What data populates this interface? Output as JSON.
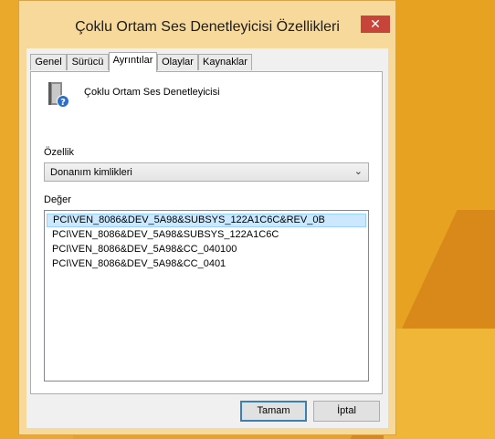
{
  "window": {
    "title": "Çoklu Ortam Ses Denetleyicisi Özellikleri",
    "close_glyph": "✕"
  },
  "tabs": [
    {
      "label": "Genel"
    },
    {
      "label": "Sürücü"
    },
    {
      "label": "Ayrıntılar",
      "active": true
    },
    {
      "label": "Olaylar"
    },
    {
      "label": "Kaynaklar"
    }
  ],
  "device": {
    "name": "Çoklu Ortam Ses Denetleyicisi",
    "icon": "speaker-question-icon"
  },
  "property": {
    "label": "Özellik",
    "selected": "Donanım kimlikleri",
    "arrow": "⌄"
  },
  "value": {
    "label": "Değer",
    "items": [
      "PCI\\VEN_8086&DEV_5A98&SUBSYS_122A1C6C&REV_0B",
      "PCI\\VEN_8086&DEV_5A98&SUBSYS_122A1C6C",
      "PCI\\VEN_8086&DEV_5A98&CC_040100",
      "PCI\\VEN_8086&DEV_5A98&CC_0401"
    ],
    "selected_index": 0
  },
  "buttons": {
    "ok": "Tamam",
    "cancel": "İptal"
  },
  "colors": {
    "title_bar": "#f6d99b",
    "close_button": "#c7443a",
    "selection": "#cce8ff",
    "desktop": "#e8a323"
  }
}
